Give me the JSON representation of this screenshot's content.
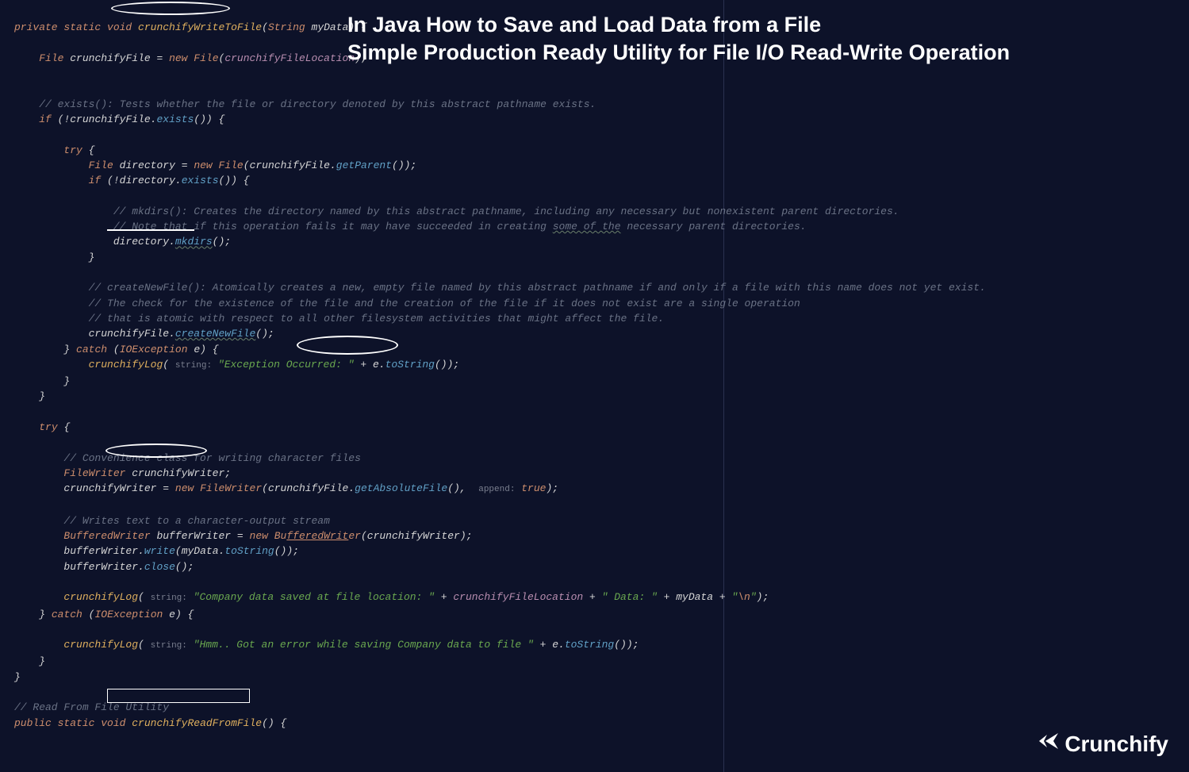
{
  "title": {
    "line1": "In Java How to Save and Load Data from a File",
    "line2": "Simple Production Ready Utility for File I/O Read-Write Operation"
  },
  "logo": "Crunchify",
  "code": {
    "l1": {
      "mods": "private static void",
      "name": "crunchifyWriteToFile",
      "ptype": "String",
      "pname": "myData"
    },
    "l2": {
      "type": "File",
      "var": "crunchifyFile",
      "eq": " = ",
      "new": "new",
      "ctor": "File",
      "arg": "crunchifyFileLocation"
    },
    "l3": "// exists(): Tests whether the file or directory denoted by this abstract pathname exists.",
    "l4": {
      "if": "if",
      "obj": "crunchifyFile",
      "m": "exists"
    },
    "l5": {
      "try": "try"
    },
    "l6": {
      "type": "File",
      "var": "directory",
      "new": "new",
      "ctor": "File",
      "obj": "crunchifyFile",
      "m": "getParent"
    },
    "l7": {
      "if": "if",
      "obj": "directory",
      "m": "exists"
    },
    "l8": "// mkdirs(): Creates the directory named by this abstract pathname, including any necessary but nonexistent parent directories.",
    "l9a": "// Note that if this operation fails it may have succeeded in creating ",
    "l9b": "some of the",
    "l9c": " necessary parent directories.",
    "l10": {
      "obj": "directory",
      "m": "mkdirs"
    },
    "l11": "// createNewFile(): Atomically creates a new, empty file named by this abstract pathname if and only if a file with this name does not yet exist.",
    "l12": "// The check for the existence of the file and the creation of the file if it does not exist are a single operation",
    "l13": "// that is atomic with respect to all other filesystem activities that might affect the file.",
    "l14": {
      "obj": "crunchifyFile",
      "m": "createNewFile"
    },
    "l15": {
      "catch": "catch",
      "extype": "IOException",
      "exvar": "e"
    },
    "l16": {
      "fn": "crunchifyLog",
      "plabel": "string:",
      "str": "\"Exception Occurred: \"",
      "plus": " + ",
      "obj": "e",
      "m": "toString"
    },
    "l17": {
      "try": "try"
    },
    "l18": "// Convenience class for writing character files",
    "l19": {
      "type": "FileWriter",
      "var": "crunchifyWriter"
    },
    "l20": {
      "var": "crunchifyWriter",
      "new": "new",
      "ctor": "FileWriter",
      "obj": "crunchifyFile",
      "m": "getAbsoluteFile",
      "plabel": "append:",
      "val": "true"
    },
    "l21": "// Writes text to a character-output stream",
    "l22": {
      "type": "BufferedWriter",
      "var": "bufferWriter",
      "new": "new",
      "ctor1": "Bu",
      "ctor2": "fferedWrit",
      "ctor3": "er",
      "arg": "crunchifyWrit",
      "arge": "er"
    },
    "l23": {
      "obj": "bufferWriter",
      "m": "write",
      "arg": "myData",
      "m2": "toString"
    },
    "l24": {
      "obj": "bufferWriter",
      "m": "close"
    },
    "l25": {
      "fn": "crunchifyLog",
      "plabel": "string:",
      "s1": "\"Company data saved at file location: \"",
      "p": " + ",
      "f": "crunchifyFileLocation",
      "s2": "\" Data: \"",
      "v": "myData",
      "s3": "\"",
      "esc": "\\n",
      "s4": "\""
    },
    "l26": {
      "catch": "catch",
      "extype": "IOException",
      "exvar": "e"
    },
    "l27": {
      "fn": "crunchifyLog",
      "plabel": "string:",
      "str": "\"Hmm.. Got an error while saving Company data to file \"",
      "plus": " + ",
      "obj": "e",
      "m": "toString"
    },
    "l28": "// Read From File Utility",
    "l29": {
      "mods": "public static void",
      "name": "crunchifyReadFromFile"
    }
  }
}
